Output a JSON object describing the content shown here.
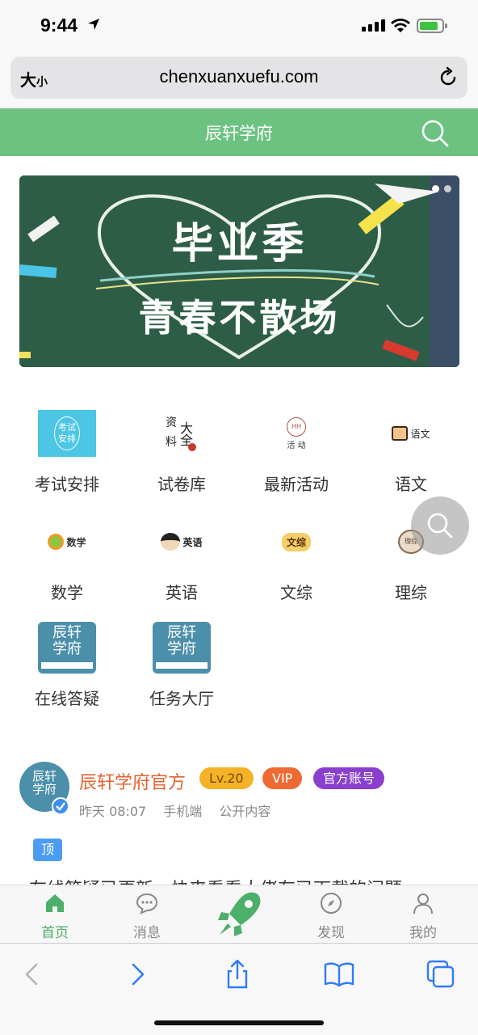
{
  "status_bar": {
    "time": "9:44"
  },
  "browser": {
    "text_size_label": "大",
    "text_size_small": "小",
    "url": "chenxuanxuefu.com"
  },
  "header": {
    "title": "辰轩学府"
  },
  "banner": {
    "line1": "毕业季",
    "line2": "青春不散场"
  },
  "menu": [
    {
      "label": "考试安排",
      "icon_text": [
        "考试",
        "安排"
      ]
    },
    {
      "label": "试卷库",
      "icon_text": [
        "资",
        "大全",
        "料"
      ]
    },
    {
      "label": "最新活动",
      "icon_text": [
        "HH",
        "活 动"
      ]
    },
    {
      "label": "语文",
      "icon_text": [
        "语文"
      ]
    },
    {
      "label": "数学",
      "icon_text": [
        "数学"
      ]
    },
    {
      "label": "英语",
      "icon_text": [
        "英语"
      ]
    },
    {
      "label": "文综",
      "icon_text": [
        "文综"
      ]
    },
    {
      "label": "理综",
      "icon_text": [
        "理综"
      ]
    },
    {
      "label": "在线答疑",
      "icon_text": [
        "辰轩",
        "学府"
      ]
    },
    {
      "label": "任务大厅",
      "icon_text": [
        "辰轩",
        "学府"
      ]
    }
  ],
  "post": {
    "author": "辰轩学府官方",
    "avatar_text": [
      "辰轩",
      "学府"
    ],
    "level": "Lv.20",
    "vip": "VIP",
    "official": "官方账号",
    "time": "昨天 08:07",
    "device": "手机端",
    "visibility": "公开内容",
    "pin_tag": "顶",
    "text": "在线答疑已更新，快来看看大佬有已下载的问题"
  },
  "tabbar": [
    {
      "label": "首页",
      "active": true
    },
    {
      "label": "消息",
      "active": false
    },
    {
      "label": "发现",
      "active": false
    },
    {
      "label": "我的",
      "active": false
    }
  ],
  "colors": {
    "brand_green": "#6cc381",
    "author_orange": "#e5632f",
    "level_badge": "#f4b227",
    "vip_badge": "#ee6a33",
    "official_badge": "#8a3fcf"
  }
}
